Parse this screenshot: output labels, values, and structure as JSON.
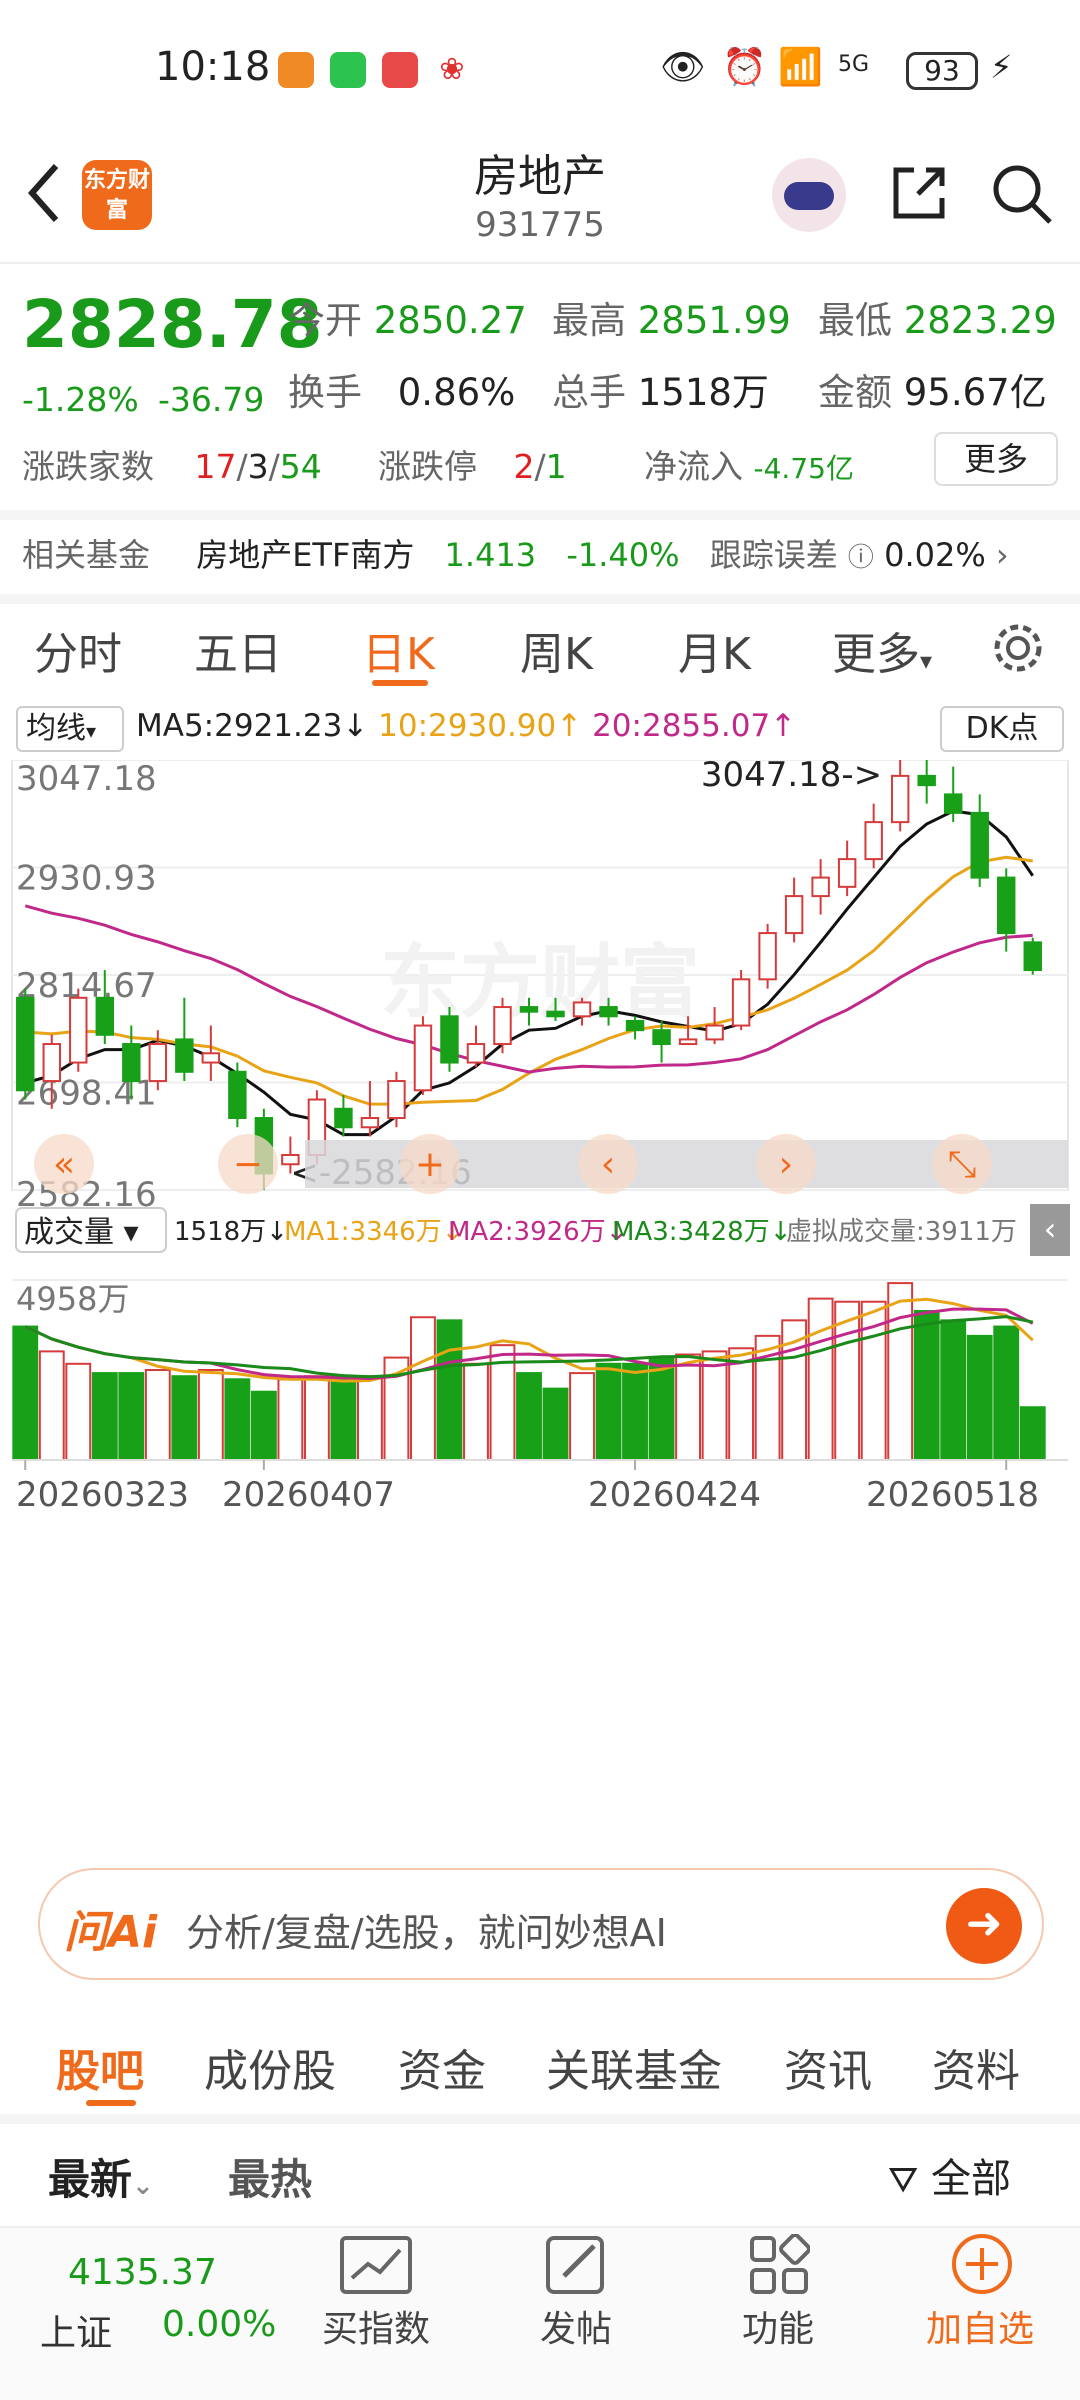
{
  "status": {
    "time": "10:18",
    "network": "5G",
    "battery": "93"
  },
  "header": {
    "title": "房地产",
    "code": "931775",
    "logo_text": "东方财富"
  },
  "quote": {
    "price": "2828.78",
    "change_pct": "-1.28%",
    "change": "-36.79",
    "open_label": "今开",
    "open": "2850.27",
    "high_label": "最高",
    "high": "2851.99",
    "low_label": "最低",
    "low": "2823.29",
    "turnover_label": "换手",
    "turnover": "0.86%",
    "volume_label": "总手",
    "volume": "1518万",
    "amount_label": "金额",
    "amount": "95.67亿",
    "updown_label": "涨跌家数",
    "up": "17",
    "flat": "3",
    "down": "54",
    "limit_label": "涨跌停",
    "limit_up": "2",
    "limit_down": "1",
    "netflow_label": "净流入",
    "netflow": "-4.75亿",
    "more_label": "更多"
  },
  "fund": {
    "label": "相关基金",
    "name": "房地产ETF南方",
    "price": "1.413",
    "pct": "-1.40%",
    "err_label": "跟踪误差",
    "err": "0.02%"
  },
  "tabs": [
    "分时",
    "五日",
    "日K",
    "周K",
    "月K",
    "更多"
  ],
  "active_tab": 2,
  "chart": {
    "ma_selector": "均线",
    "ma5": "MA5:2921.23↓",
    "ma10": "10:2930.90↑",
    "ma20": "20:2855.07↑",
    "dk_label": "DK点",
    "y_labels": [
      "3047.18",
      "2930.93",
      "2814.67",
      "2698.41",
      "2582.16"
    ],
    "high_marker": "3047.18->",
    "low_marker": "<-2582.16",
    "watermark": "东方财富",
    "vol_selector": "成交量",
    "vol_now": "1518万↓",
    "vol_ma1": "MA1:3346万↓",
    "vol_ma2": "MA2:3926万↓",
    "vol_ma3": "MA3:3428万↓",
    "vol_virtual": "虚拟成交量:3911万",
    "vol_max": "4958万",
    "dates": [
      "20260323",
      "20260407",
      "20260424",
      "20260518"
    ],
    "colors": {
      "up": "#d63b3b",
      "down": "#18a018",
      "ma5": "#111111",
      "ma10": "#e8a317",
      "ma20": "#c0288a"
    }
  },
  "chart_data": {
    "type": "candlestick",
    "ylim": [
      2582.16,
      3047.18
    ],
    "candles": [
      [
        2790,
        2690,
        2800,
        2680
      ],
      [
        2700,
        2740,
        2750,
        2670
      ],
      [
        2720,
        2790,
        2800,
        2710
      ],
      [
        2790,
        2750,
        2820,
        2740
      ],
      [
        2740,
        2700,
        2760,
        2680
      ],
      [
        2700,
        2740,
        2755,
        2690
      ],
      [
        2745,
        2710,
        2790,
        2700
      ],
      [
        2720,
        2730,
        2760,
        2700
      ],
      [
        2710,
        2660,
        2720,
        2650
      ],
      [
        2660,
        2600,
        2670,
        2582.16
      ],
      [
        2610,
        2620,
        2640,
        2600
      ],
      [
        2620,
        2680,
        2690,
        2610
      ],
      [
        2670,
        2650,
        2685,
        2640
      ],
      [
        2650,
        2660,
        2700,
        2640
      ],
      [
        2660,
        2700,
        2710,
        2650
      ],
      [
        2690,
        2760,
        2770,
        2685
      ],
      [
        2770,
        2720,
        2780,
        2710
      ],
      [
        2720,
        2740,
        2760,
        2715
      ],
      [
        2740,
        2780,
        2790,
        2730
      ],
      [
        2780,
        2775,
        2790,
        2760
      ],
      [
        2775,
        2770,
        2790,
        2765
      ],
      [
        2770,
        2785,
        2790,
        2760
      ],
      [
        2780,
        2770,
        2790,
        2760
      ],
      [
        2765,
        2755,
        2770,
        2745
      ],
      [
        2755,
        2740,
        2765,
        2720
      ],
      [
        2740,
        2745,
        2770,
        2740
      ],
      [
        2745,
        2760,
        2780,
        2740
      ],
      [
        2760,
        2810,
        2820,
        2755
      ],
      [
        2810,
        2860,
        2870,
        2800
      ],
      [
        2860,
        2900,
        2920,
        2850
      ],
      [
        2900,
        2920,
        2940,
        2880
      ],
      [
        2910,
        2940,
        2960,
        2900
      ],
      [
        2940,
        2980,
        3000,
        2930
      ],
      [
        2980,
        3030,
        3047.18,
        2970
      ],
      [
        3030,
        3020,
        3047.18,
        3000
      ],
      [
        3010,
        2990,
        3040,
        2980
      ],
      [
        2990,
        2920,
        3010,
        2910
      ],
      [
        2920,
        2860,
        2930,
        2840
      ],
      [
        2850,
        2820,
        2855,
        2815
      ]
    ],
    "volumes": [
      4300,
      3500,
      3100,
      2800,
      2800,
      2900,
      2700,
      2900,
      2600,
      2200,
      2600,
      2700,
      2600,
      2700,
      3300,
      4600,
      4500,
      3100,
      3700,
      2800,
      2300,
      2800,
      3100,
      3100,
      3300,
      3400,
      3500,
      3600,
      4000,
      4500,
      5200,
      5100,
      5100,
      5700,
      4800,
      4500,
      4000,
      4300,
      1700
    ],
    "series_lines": [
      "MA5",
      "MA10",
      "MA20"
    ]
  },
  "ai_bar": {
    "logo": "问Ai",
    "placeholder": "分析/复盘/选股，就问妙想AI"
  },
  "bottom_tabs": [
    "股吧",
    "成份股",
    "资金",
    "关联基金",
    "资讯",
    "资料"
  ],
  "feed": {
    "latest": "最新",
    "hot": "最热",
    "filter": "全部"
  },
  "navbar": {
    "index_value": "4135.37",
    "index_name": "上证",
    "index_pct": "0.00%",
    "buy_index": "买指数",
    "post": "发帖",
    "func": "功能",
    "add": "加自选"
  }
}
